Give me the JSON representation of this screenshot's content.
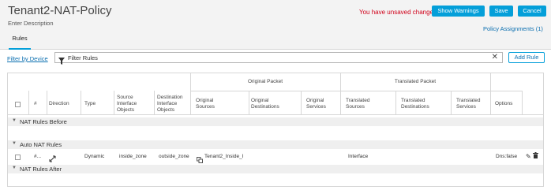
{
  "header": {
    "title": "Tenant2-NAT-Policy",
    "description": "Enter Description",
    "unsaved_text": "You have unsaved changes",
    "show_warnings_label": "Show Warnings",
    "save_label": "Save",
    "cancel_label": "Cancel",
    "policy_assignments": "Policy Assignments (1)",
    "tab_rules": "Rules"
  },
  "filter": {
    "by_device": "Filter by Device",
    "text": "Filter Rules",
    "add_rule": "Add Rule"
  },
  "table": {
    "groups": {
      "original": "Original Packet",
      "translated": "Translated Packet"
    },
    "columns": {
      "num": "#",
      "direction": "Direction",
      "type": "Type",
      "source_if": [
        "Source",
        "Interface",
        "Objects"
      ],
      "dest_if": [
        "Destination",
        "Interface",
        "Objects"
      ],
      "orig_sources": [
        "Original",
        "Sources"
      ],
      "orig_dests": [
        "Original",
        "Destinations"
      ],
      "orig_services": [
        "Original",
        "Services"
      ],
      "trans_sources": [
        "Translated",
        "Sources"
      ],
      "trans_dests": [
        "Translated",
        "Destinations"
      ],
      "trans_services": [
        "Translated",
        "Services"
      ],
      "options": "Options"
    },
    "sections": {
      "before": "NAT Rules Before",
      "auto": "Auto NAT Rules",
      "after": "NAT Rules After"
    },
    "rows": [
      {
        "num": "#...",
        "type": "Dynamic",
        "source_if": "inside_zone",
        "dest_if": "outside_zone",
        "orig_sources": "Tenant2_Inside_I",
        "trans_sources": "Interface",
        "options": "Dns:false"
      }
    ]
  },
  "colors": {
    "primary_button": "#049fd9",
    "link": "#0b6fb0",
    "warning_text": "#d0021b"
  },
  "icons": {
    "filter": "filter-icon",
    "clear": "close-icon",
    "direction": "bidirectional-arrow-icon",
    "network_object": "network-object-icon",
    "edit": "pencil-icon",
    "delete": "trash-icon",
    "section_toggle": "chevron-down-icon"
  }
}
